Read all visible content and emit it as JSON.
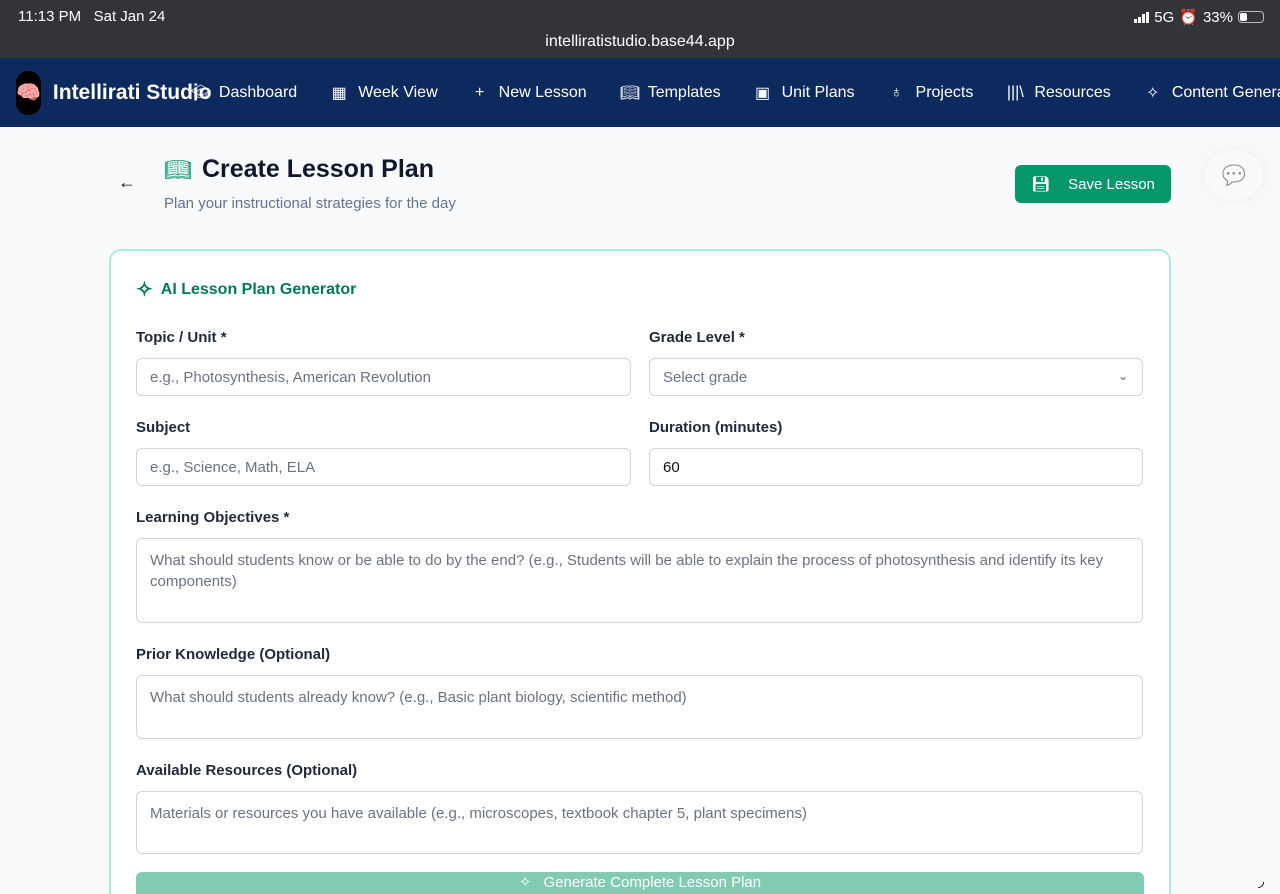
{
  "status_bar": {
    "time": "11:13 PM",
    "date": "Sat Jan 24",
    "network": "5G",
    "battery": "33%",
    "url": "intelliratistudio.base44.app"
  },
  "nav": {
    "brand": "Intellirati Studio",
    "items": [
      {
        "label": "Dashboard",
        "icon": "graduation-cap-icon"
      },
      {
        "label": "Week View",
        "icon": "calendar-icon"
      },
      {
        "label": "New Lesson",
        "icon": "plus-icon"
      },
      {
        "label": "Templates",
        "icon": "book-open-icon"
      },
      {
        "label": "Unit Plans",
        "icon": "folder-icon"
      },
      {
        "label": "Projects",
        "icon": "lightbulb-icon"
      },
      {
        "label": "Resources",
        "icon": "library-icon"
      },
      {
        "label": "Content Genera",
        "icon": "sparkles-icon"
      }
    ]
  },
  "header": {
    "title": "Create Lesson Plan",
    "subtitle": "Plan your instructional strategies for the day",
    "save_label": "Save Lesson"
  },
  "generator": {
    "title": "AI Lesson Plan Generator",
    "topic": {
      "label": "Topic / Unit *",
      "placeholder": "e.g., Photosynthesis, American Revolution"
    },
    "grade": {
      "label": "Grade Level *",
      "placeholder": "Select grade"
    },
    "subject": {
      "label": "Subject",
      "placeholder": "e.g., Science, Math, ELA"
    },
    "duration": {
      "label": "Duration (minutes)",
      "value": "60"
    },
    "objectives": {
      "label": "Learning Objectives *",
      "placeholder": "What should students know or be able to do by the end? (e.g., Students will be able to explain the process of photosynthesis and identify its key components)"
    },
    "prior": {
      "label": "Prior Knowledge (Optional)",
      "placeholder": "What should students already know? (e.g., Basic plant biology, scientific method)"
    },
    "resources": {
      "label": "Available Resources (Optional)",
      "placeholder": "Materials or resources you have available (e.g., microscopes, textbook chapter 5, plant specimens)"
    },
    "generate_label": "Generate Complete Lesson Plan"
  }
}
